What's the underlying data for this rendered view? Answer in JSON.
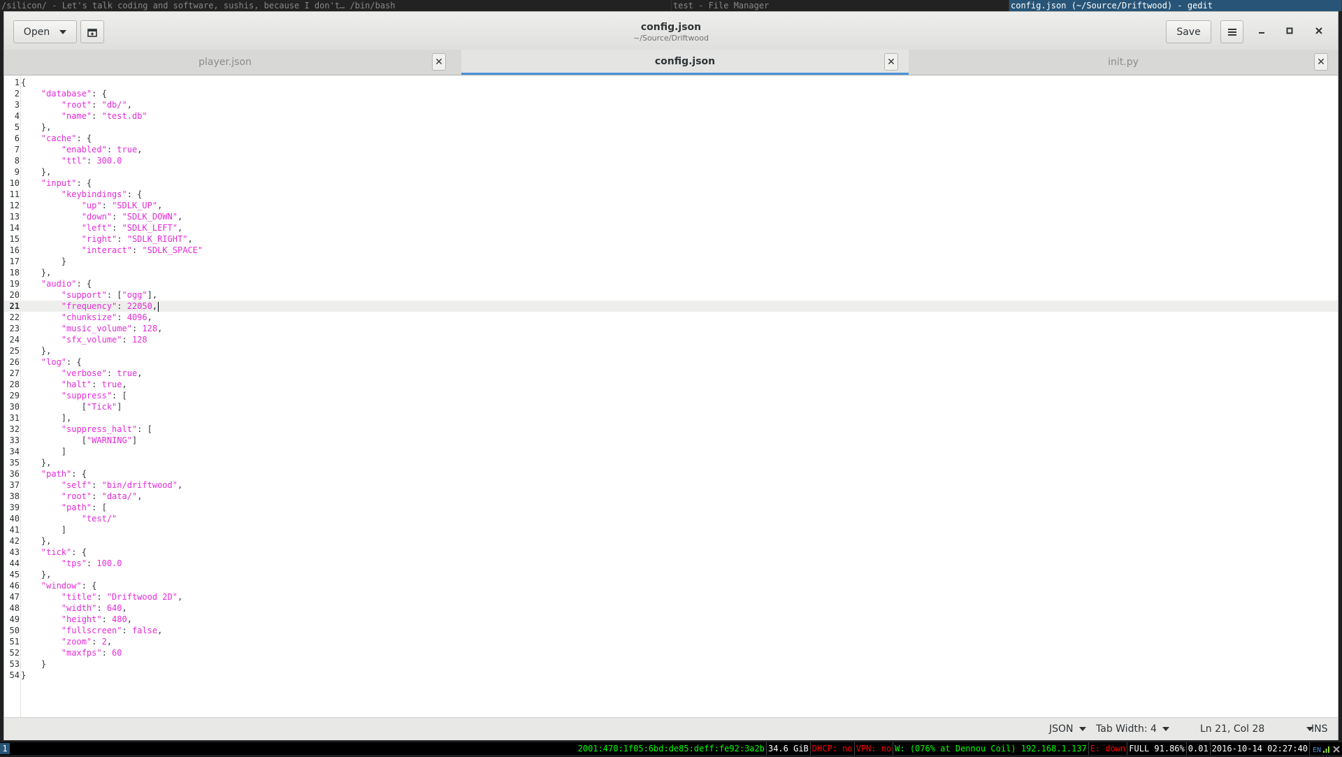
{
  "wm": {
    "tabs": [
      {
        "label": "/silicon/ - Let's talk coding and software, sushis, because I don't… /bin/bash",
        "active": false
      },
      {
        "label": "test - File Manager",
        "active": false
      },
      {
        "label": "config.json (~/Source/Driftwood) - gedit",
        "active": true
      }
    ]
  },
  "header": {
    "open_label": "Open",
    "save_label": "Save",
    "title": "config.json",
    "subtitle": "~/Source/Driftwood",
    "icons": {
      "new": "new-tab-icon",
      "menu": "hamburger-menu-icon",
      "min": "minimize-icon",
      "max": "maximize-icon",
      "close": "close-icon"
    }
  },
  "tabs": [
    {
      "label": "player.json",
      "active": false
    },
    {
      "label": "config.json",
      "active": true
    },
    {
      "label": "init.py",
      "active": false
    }
  ],
  "editor": {
    "current_line": 21,
    "lines": [
      "{",
      "    \"database\": {",
      "        \"root\": \"db/\",",
      "        \"name\": \"test.db\"",
      "    },",
      "    \"cache\": {",
      "        \"enabled\": true,",
      "        \"ttl\": 300.0",
      "    },",
      "    \"input\": {",
      "        \"keybindings\": {",
      "            \"up\": \"SDLK_UP\",",
      "            \"down\": \"SDLK_DOWN\",",
      "            \"left\": \"SDLK_LEFT\",",
      "            \"right\": \"SDLK_RIGHT\",",
      "            \"interact\": \"SDLK_SPACE\"",
      "        }",
      "    },",
      "    \"audio\": {",
      "        \"support\": [\"ogg\"],",
      "        \"frequency\": 22050,",
      "        \"chunksize\": 4096,",
      "        \"music_volume\": 128,",
      "        \"sfx_volume\": 128",
      "    },",
      "    \"log\": {",
      "        \"verbose\": true,",
      "        \"halt\": true,",
      "        \"suppress\": [",
      "            [\"Tick\"]",
      "        ],",
      "        \"suppress_halt\": [",
      "            [\"WARNING\"]",
      "        ]",
      "    },",
      "    \"path\": {",
      "        \"self\": \"bin/driftwood\",",
      "        \"root\": \"data/\",",
      "        \"path\": [",
      "            \"test/\"",
      "        ]",
      "    },",
      "    \"tick\": {",
      "        \"tps\": 100.0",
      "    },",
      "    \"window\": {",
      "        \"title\": \"Driftwood 2D\",",
      "        \"width\": 640,",
      "        \"height\": 480,",
      "        \"fullscreen\": false,",
      "        \"zoom\": 2,",
      "        \"maxfps\": 60",
      "    }",
      "}"
    ]
  },
  "status": {
    "language": "JSON",
    "tab_width": "Tab Width: 4",
    "position": "Ln 21, Col 28",
    "mode": "INS"
  },
  "i3bar": {
    "workspace": "1",
    "ipv6": "2001:470:1f05:6bd:de85:deff:fe92:3a2b",
    "disk": "34.6 GiB",
    "dhcp": "DHCP: no",
    "vpn": "VPN: no",
    "wifi": "W: (076% at Dennou Coil) 192.168.1.137",
    "eth": "E: down",
    "battery": "FULL 91.86%",
    "load": "0.01",
    "datetime": "2016-10-14 02:27:40",
    "lang": "EN"
  }
}
